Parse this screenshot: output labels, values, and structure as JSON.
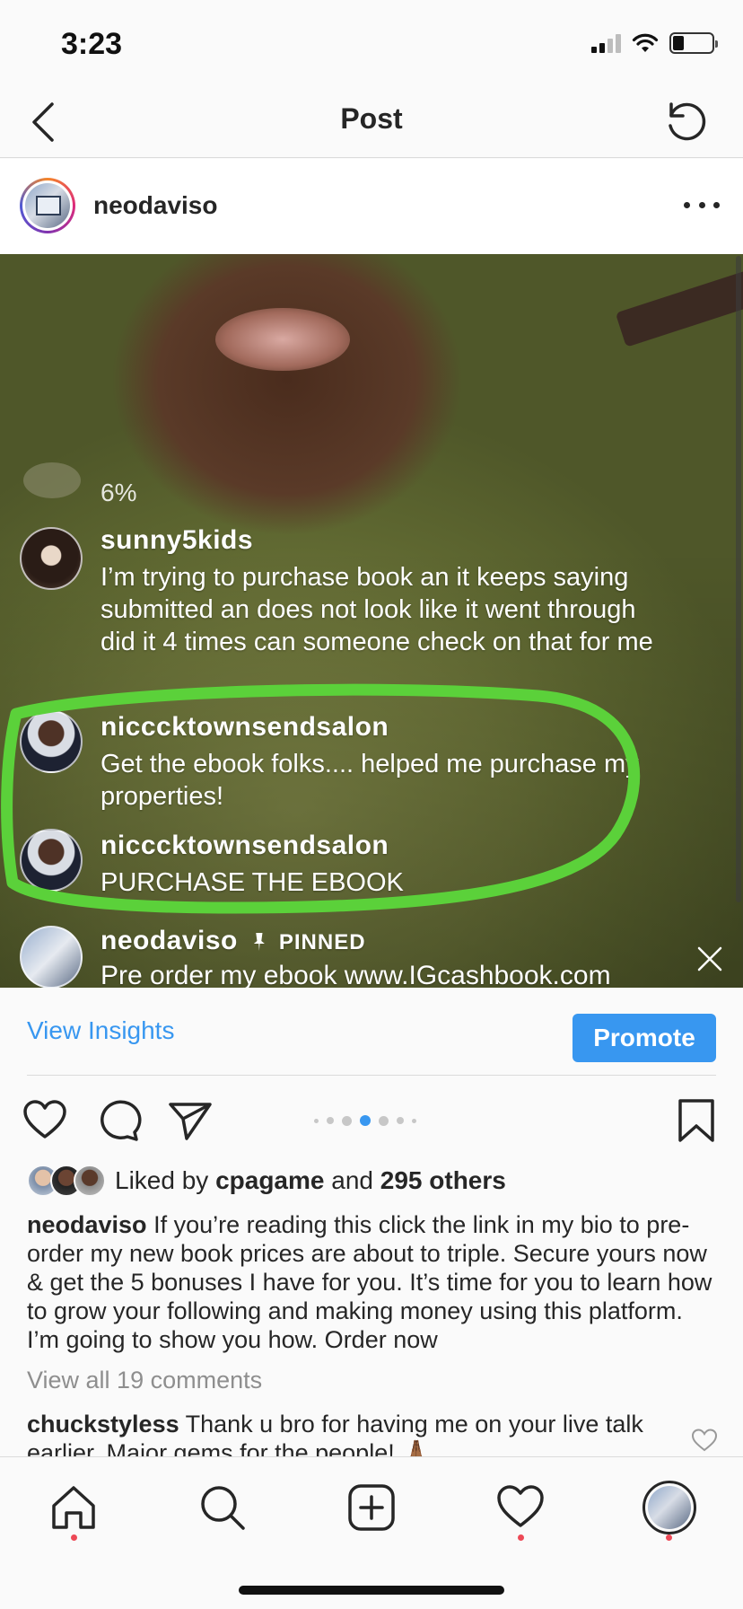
{
  "status_bar": {
    "time": "3:23"
  },
  "nav": {
    "title": "Post"
  },
  "post": {
    "username": "neodaviso",
    "live_comments": {
      "percent": "6%",
      "items": [
        {
          "username": "sunny5kids",
          "text": "I’m trying to purchase book an it keeps saying submitted an does not look like it went through did it 4 times can someone check on that for me"
        },
        {
          "username": "nicccktownsendsalon",
          "text": "Get the ebook folks.... helped me purchase my properties!"
        },
        {
          "username": "nicccktownsendsalon",
          "text": "PURCHASE THE EBOOK"
        }
      ],
      "pinned": {
        "username": "neodaviso",
        "tag": "PINNED",
        "text": "Pre order my ebook www.IGcashbook.com"
      }
    },
    "insights_label": "View Insights",
    "promote_label": "Promote",
    "likes": {
      "prefix": "Liked by",
      "user": "cpagame",
      "middle": "and",
      "count": "295 others"
    },
    "caption": {
      "username": "neodaviso",
      "text": "If you’re reading this click the link in my bio to pre-order my new book prices are about to triple. Secure yours now & get the 5 bonuses I have for you. It’s time for you to learn how to grow your following and making money using this platform. I’m going to show you how. Order now"
    },
    "view_comments": "View all 19 comments",
    "comment": {
      "username": "chuckstyless",
      "text": "Thank u bro for having me on your live talk earlier. Major gems for the people! 🙏🏾"
    },
    "carousel": {
      "count": 7,
      "active_index": 3
    }
  },
  "colors": {
    "accent": "#3897f0",
    "highlight": "#5bd13a",
    "notification": "#ed4956"
  }
}
